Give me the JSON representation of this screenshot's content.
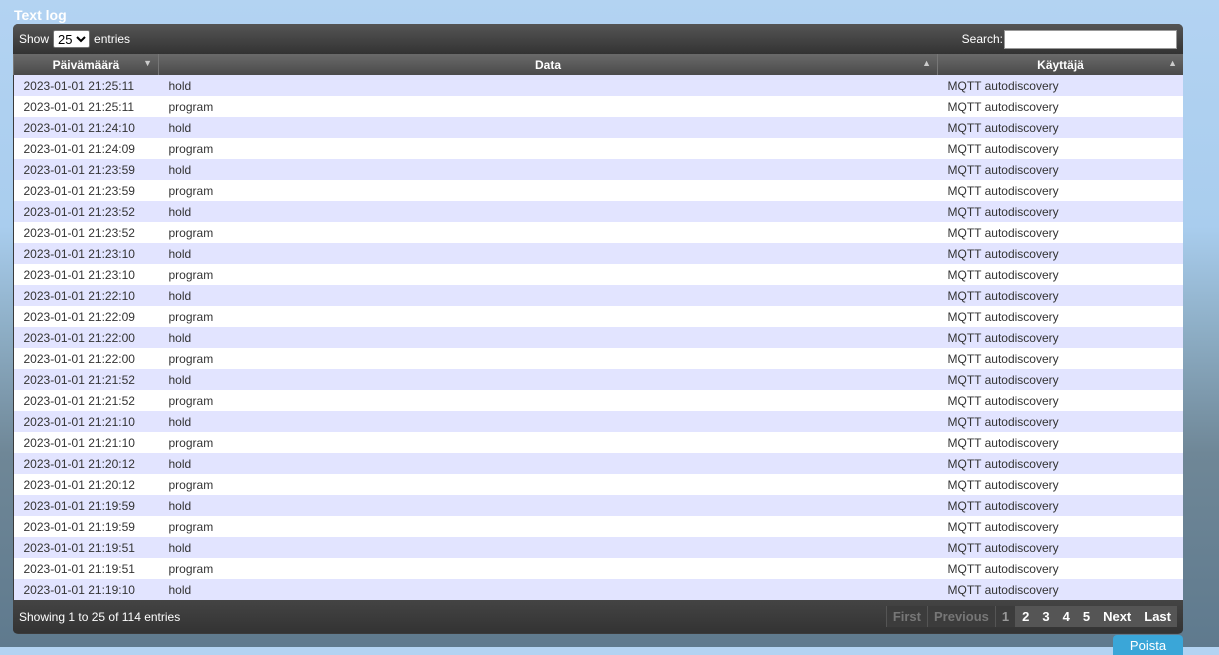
{
  "title": "Text log",
  "toolbar": {
    "show_label": "Show",
    "page_size": "25",
    "entries_label": "entries",
    "search_label": "Search:",
    "search_value": ""
  },
  "columns": [
    "Päivämäärä",
    "Data",
    "Käyttäjä"
  ],
  "rows": [
    [
      "2023-01-01 21:25:11",
      "hold",
      "MQTT autodiscovery"
    ],
    [
      "2023-01-01 21:25:11",
      "program",
      "MQTT autodiscovery"
    ],
    [
      "2023-01-01 21:24:10",
      "hold",
      "MQTT autodiscovery"
    ],
    [
      "2023-01-01 21:24:09",
      "program",
      "MQTT autodiscovery"
    ],
    [
      "2023-01-01 21:23:59",
      "hold",
      "MQTT autodiscovery"
    ],
    [
      "2023-01-01 21:23:59",
      "program",
      "MQTT autodiscovery"
    ],
    [
      "2023-01-01 21:23:52",
      "hold",
      "MQTT autodiscovery"
    ],
    [
      "2023-01-01 21:23:52",
      "program",
      "MQTT autodiscovery"
    ],
    [
      "2023-01-01 21:23:10",
      "hold",
      "MQTT autodiscovery"
    ],
    [
      "2023-01-01 21:23:10",
      "program",
      "MQTT autodiscovery"
    ],
    [
      "2023-01-01 21:22:10",
      "hold",
      "MQTT autodiscovery"
    ],
    [
      "2023-01-01 21:22:09",
      "program",
      "MQTT autodiscovery"
    ],
    [
      "2023-01-01 21:22:00",
      "hold",
      "MQTT autodiscovery"
    ],
    [
      "2023-01-01 21:22:00",
      "program",
      "MQTT autodiscovery"
    ],
    [
      "2023-01-01 21:21:52",
      "hold",
      "MQTT autodiscovery"
    ],
    [
      "2023-01-01 21:21:52",
      "program",
      "MQTT autodiscovery"
    ],
    [
      "2023-01-01 21:21:10",
      "hold",
      "MQTT autodiscovery"
    ],
    [
      "2023-01-01 21:21:10",
      "program",
      "MQTT autodiscovery"
    ],
    [
      "2023-01-01 21:20:12",
      "hold",
      "MQTT autodiscovery"
    ],
    [
      "2023-01-01 21:20:12",
      "program",
      "MQTT autodiscovery"
    ],
    [
      "2023-01-01 21:19:59",
      "hold",
      "MQTT autodiscovery"
    ],
    [
      "2023-01-01 21:19:59",
      "program",
      "MQTT autodiscovery"
    ],
    [
      "2023-01-01 21:19:51",
      "hold",
      "MQTT autodiscovery"
    ],
    [
      "2023-01-01 21:19:51",
      "program",
      "MQTT autodiscovery"
    ],
    [
      "2023-01-01 21:19:10",
      "hold",
      "MQTT autodiscovery"
    ]
  ],
  "footer": {
    "info": "Showing 1 to 25 of 114 entries",
    "pagination": [
      {
        "label": "First",
        "state": "disabled"
      },
      {
        "label": "Previous",
        "state": "disabled"
      },
      {
        "label": "1",
        "state": "current"
      },
      {
        "label": "2",
        "state": "active"
      },
      {
        "label": "3",
        "state": "active"
      },
      {
        "label": "4",
        "state": "active"
      },
      {
        "label": "5",
        "state": "active"
      },
      {
        "label": "Next",
        "state": "active"
      },
      {
        "label": "Last",
        "state": "active"
      }
    ]
  },
  "delete_button": "Poista"
}
